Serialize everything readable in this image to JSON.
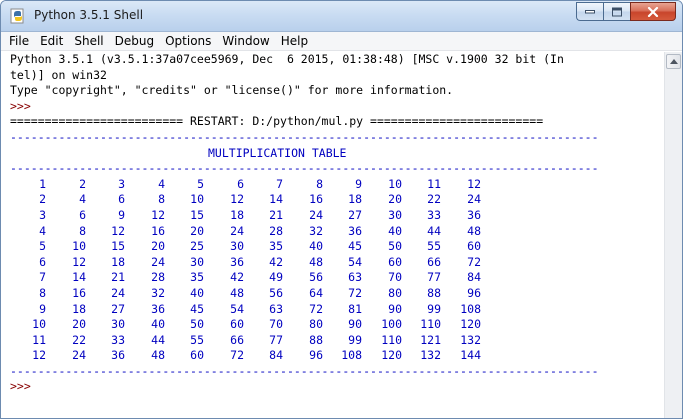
{
  "window": {
    "title": "Python 3.5.1 Shell"
  },
  "menu": [
    "File",
    "Edit",
    "Shell",
    "Debug",
    "Options",
    "Window",
    "Help"
  ],
  "console": {
    "banner_line1": "Python 3.5.1 (v3.5.1:37a07cee5969, Dec  6 2015, 01:38:48) [MSC v.1900 32 bit (In",
    "banner_line2": "tel)] on win32",
    "info_line": "Type \"copyright\", \"credits\" or \"license()\" for more information.",
    "prompt": ">>> ",
    "restart_line": "========================= RESTART: D:/python/mul.py =========================",
    "dash_line": "-------------------------------------------------------------------------------------",
    "table_title": "MULTIPLICATION TABLE",
    "final_prompt": ">>> "
  },
  "table": {
    "rows": [
      [
        "1",
        "2",
        "3",
        "4",
        "5",
        "6",
        "7",
        "8",
        "9",
        "10",
        "11",
        "12"
      ],
      [
        "2",
        "4",
        "6",
        "8",
        "10",
        "12",
        "14",
        "16",
        "18",
        "20",
        "22",
        "24"
      ],
      [
        "3",
        "6",
        "9",
        "12",
        "15",
        "18",
        "21",
        "24",
        "27",
        "30",
        "33",
        "36"
      ],
      [
        "4",
        "8",
        "12",
        "16",
        "20",
        "24",
        "28",
        "32",
        "36",
        "40",
        "44",
        "48"
      ],
      [
        "5",
        "10",
        "15",
        "20",
        "25",
        "30",
        "35",
        "40",
        "45",
        "50",
        "55",
        "60"
      ],
      [
        "6",
        "12",
        "18",
        "24",
        "30",
        "36",
        "42",
        "48",
        "54",
        "60",
        "66",
        "72"
      ],
      [
        "7",
        "14",
        "21",
        "28",
        "35",
        "42",
        "49",
        "56",
        "63",
        "70",
        "77",
        "84"
      ],
      [
        "8",
        "16",
        "24",
        "32",
        "40",
        "48",
        "56",
        "64",
        "72",
        "80",
        "88",
        "96"
      ],
      [
        "9",
        "18",
        "27",
        "36",
        "45",
        "54",
        "63",
        "72",
        "81",
        "90",
        "99",
        "108"
      ],
      [
        "10",
        "20",
        "30",
        "40",
        "50",
        "60",
        "70",
        "80",
        "90",
        "100",
        "110",
        "120"
      ],
      [
        "11",
        "22",
        "33",
        "44",
        "55",
        "66",
        "77",
        "88",
        "99",
        "110",
        "121",
        "132"
      ],
      [
        "12",
        "24",
        "36",
        "48",
        "60",
        "72",
        "84",
        "96",
        "108",
        "120",
        "132",
        "144"
      ]
    ]
  },
  "colors": {
    "output_blue": "#0000c0",
    "prompt_maroon": "#880000",
    "title_bar": "#c9dcf2",
    "close_button": "#c8452c"
  },
  "icons": {
    "app": "python-idle-icon",
    "minimize": "minimize-icon",
    "maximize": "maximize-icon",
    "close": "close-icon",
    "scroll_up": "scroll-up-arrow-icon"
  }
}
